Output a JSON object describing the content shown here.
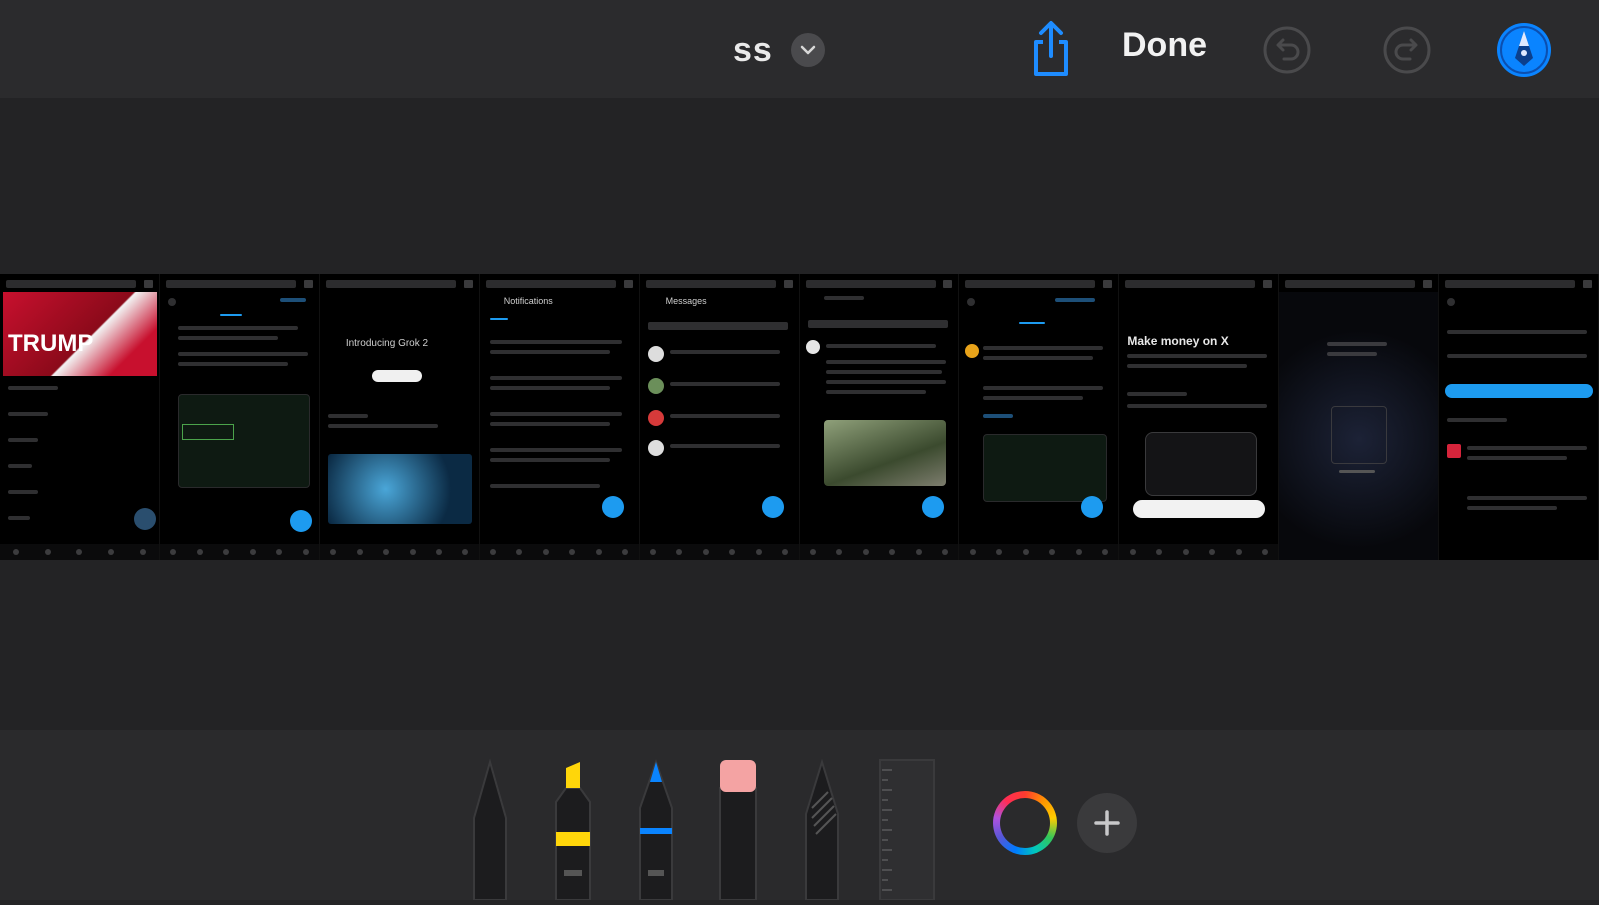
{
  "header": {
    "title": "ss",
    "done_label": "Done"
  },
  "icons": {
    "title_menu": "chevron-down-icon",
    "share": "share-icon",
    "undo": "undo-icon",
    "redo": "redo-icon",
    "markup": "markup-pen-icon"
  },
  "screenshots": [
    {
      "heading": "TRUMP",
      "caption": ""
    },
    {
      "heading": "",
      "caption": ""
    },
    {
      "heading": "Introducing Grok 2",
      "caption": ""
    },
    {
      "heading": "Notifications",
      "caption": ""
    },
    {
      "heading": "Messages",
      "caption": ""
    },
    {
      "heading": "",
      "caption": ""
    },
    {
      "heading": "",
      "caption": ""
    },
    {
      "heading": "Make money on X",
      "caption": ""
    },
    {
      "heading": "",
      "caption": ""
    },
    {
      "heading": "",
      "caption": ""
    }
  ],
  "tools": [
    {
      "name": "pen-tool"
    },
    {
      "name": "highlighter-tool",
      "color": "#ffd60a"
    },
    {
      "name": "pencil-tool",
      "color": "#0a84ff"
    },
    {
      "name": "eraser-tool",
      "color": "#f4a3a3"
    },
    {
      "name": "lasso-tool"
    },
    {
      "name": "ruler-tool"
    }
  ],
  "colors": {
    "accent": "#0a84ff",
    "fab": "#1d9bf0"
  }
}
